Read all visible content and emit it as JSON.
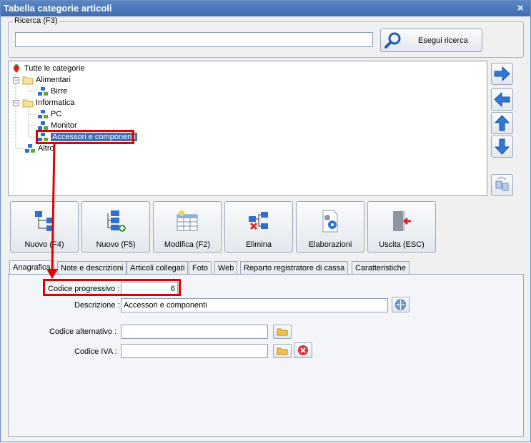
{
  "window": {
    "title": "Tabella categorie articoli",
    "close_glyph": "×"
  },
  "search": {
    "group_label": "Ricerca (F3)",
    "value": "",
    "button_label": "Esegui ricerca"
  },
  "tree": {
    "items": [
      {
        "label": "Tutte le categorie",
        "icon": "strawberry-icon"
      },
      {
        "label": "Alimentari",
        "icon": "folder-icon",
        "expander": "−"
      },
      {
        "label": "Birre",
        "icon": "category-icon"
      },
      {
        "label": "Informatica",
        "icon": "folder-icon",
        "expander": "−"
      },
      {
        "label": "PC",
        "icon": "category-icon"
      },
      {
        "label": "Monitor",
        "icon": "category-icon"
      },
      {
        "label": "Accessori e componenti",
        "icon": "category-icon",
        "selected": true
      },
      {
        "label": "Altro",
        "icon": "category-icon"
      }
    ]
  },
  "side_buttons": [
    "arrow-right-icon",
    "arrow-left-icon",
    "arrow-up-icon",
    "arrow-down-icon",
    "swap-icon"
  ],
  "toolbar": {
    "buttons": [
      {
        "label": "Nuovo (F4)",
        "icon": "new-sibling-icon"
      },
      {
        "label": "Nuovo (F5)",
        "icon": "new-child-icon"
      },
      {
        "label": "Modifica (F2)",
        "icon": "edit-table-icon"
      },
      {
        "label": "Elimina",
        "icon": "delete-node-icon"
      },
      {
        "label": "Elaborazioni",
        "icon": "gear-document-icon"
      },
      {
        "label": "Uscita (ESC)",
        "icon": "exit-door-icon"
      }
    ]
  },
  "tabs": [
    {
      "label": "Anagrafica",
      "active": true
    },
    {
      "label": "Note e descrizioni"
    },
    {
      "label": "Articoli collegati"
    },
    {
      "label": "Foto"
    },
    {
      "label": "Web"
    },
    {
      "label": "Reparto registratore di cassa"
    },
    {
      "label": "Caratteristiche"
    }
  ],
  "form": {
    "codice_progressivo": {
      "label": "Codice progressivo :",
      "value": "6"
    },
    "descrizione": {
      "label": "Descrizione :",
      "value": "Accessori e componenti"
    },
    "codice_alternativo": {
      "label": "Codice alternativo :",
      "value": ""
    },
    "codice_iva": {
      "label": "Codice IVA :",
      "value": ""
    }
  },
  "colors": {
    "title_bar": "#4a7bc0",
    "highlight": "#e00000",
    "selection": "#3d6fb5"
  }
}
